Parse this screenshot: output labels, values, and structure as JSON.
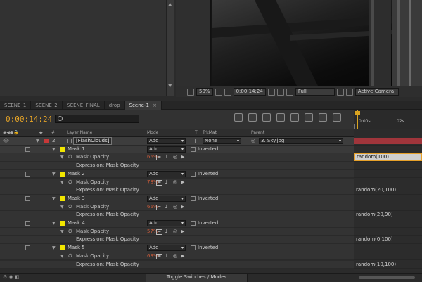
{
  "viewer": {
    "zoom": "50%",
    "timecode": "0:00:14:24",
    "resolution": "Full",
    "camera": "Active Camera"
  },
  "tabs": [
    {
      "label": "SCENE_1"
    },
    {
      "label": "SCENE_2"
    },
    {
      "label": "SCENE_FINAL"
    },
    {
      "label": "drop"
    },
    {
      "label": "Scene-1",
      "close": "×"
    }
  ],
  "timeline": {
    "timecode": "0:00:14:24",
    "search_placeholder": "",
    "ruler": {
      "start": "0:00s",
      "mark": "02s"
    }
  },
  "headers": {
    "num": "#",
    "layer_name": "Layer Name",
    "mode": "Mode",
    "t": "T",
    "trkmat": "TrkMat",
    "parent": "Parent"
  },
  "layer": {
    "number": "2",
    "name": "[FlashClouds]",
    "mode": "Add",
    "trkmat": "None",
    "parent": "3. Sky.jpg"
  },
  "masks": [
    {
      "name": "Mask 1",
      "mode": "Add",
      "inverted": "Inverted",
      "opacity_label": "Mask Opacity",
      "opacity": "66",
      "expr_label": "Expression: Mask Opacity",
      "expression": "random(100)"
    },
    {
      "name": "Mask 2",
      "mode": "Add",
      "inverted": "Inverted",
      "opacity_label": "Mask Opacity",
      "opacity": "78",
      "expr_label": "Expression: Mask Opacity",
      "expression": "random(20,100)"
    },
    {
      "name": "Mask 3",
      "mode": "Add",
      "inverted": "Inverted",
      "opacity_label": "Mask Opacity",
      "opacity": "66",
      "expr_label": "Expression: Mask Opacity",
      "expression": "random(20,90)"
    },
    {
      "name": "Mask 4",
      "mode": "Add",
      "inverted": "Inverted",
      "opacity_label": "Mask Opacity",
      "opacity": "57",
      "expr_label": "Expression: Mask Opacity",
      "expression": "random(0,100)"
    },
    {
      "name": "Mask 5",
      "mode": "Add",
      "inverted": "Inverted",
      "opacity_label": "Mask Opacity",
      "opacity": "63",
      "expr_label": "Expression: Mask Opacity",
      "expression": "random(10,100)"
    }
  ],
  "percent_sign": "%",
  "footer": {
    "toggle": "Toggle Switches / Modes"
  },
  "colors": {
    "accent": "#e7a527",
    "label_yellow": "#f2e600",
    "layer_bar": "#a0353b"
  }
}
